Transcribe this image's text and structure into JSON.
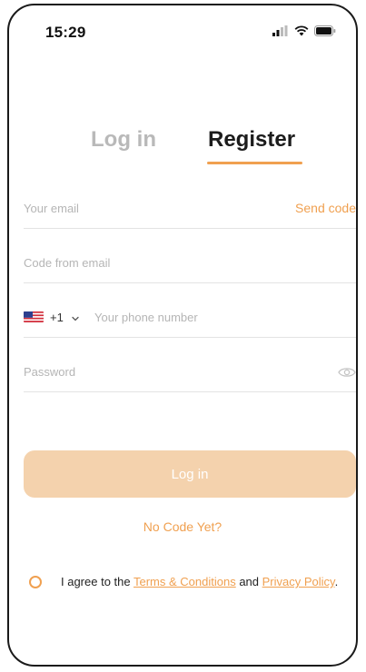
{
  "status_bar": {
    "time": "15:29"
  },
  "tabs": {
    "login": "Log in",
    "register": "Register"
  },
  "form": {
    "email": {
      "placeholder": "Your email",
      "value": ""
    },
    "send_code": "Send code",
    "code": {
      "placeholder": "Code from email",
      "value": ""
    },
    "phone": {
      "dial_code": "+1",
      "placeholder": "Your phone number",
      "value": ""
    },
    "password": {
      "placeholder": "Password",
      "value": ""
    }
  },
  "login_button": "Log in",
  "no_code_link": "No Code Yet?",
  "agreement": {
    "prefix": "I agree to the ",
    "terms": "Terms & Conditions",
    "middle": " and ",
    "privacy": "Privacy Policy",
    "suffix": "."
  },
  "colors": {
    "accent": "#f0a050",
    "button_disabled": "#f4d2ad",
    "inactive_tab": "#b9b9b9"
  },
  "icons": {
    "country_flag": "us-flag-icon",
    "chevron": "chevron-down-icon",
    "password_toggle": "eye-icon"
  }
}
